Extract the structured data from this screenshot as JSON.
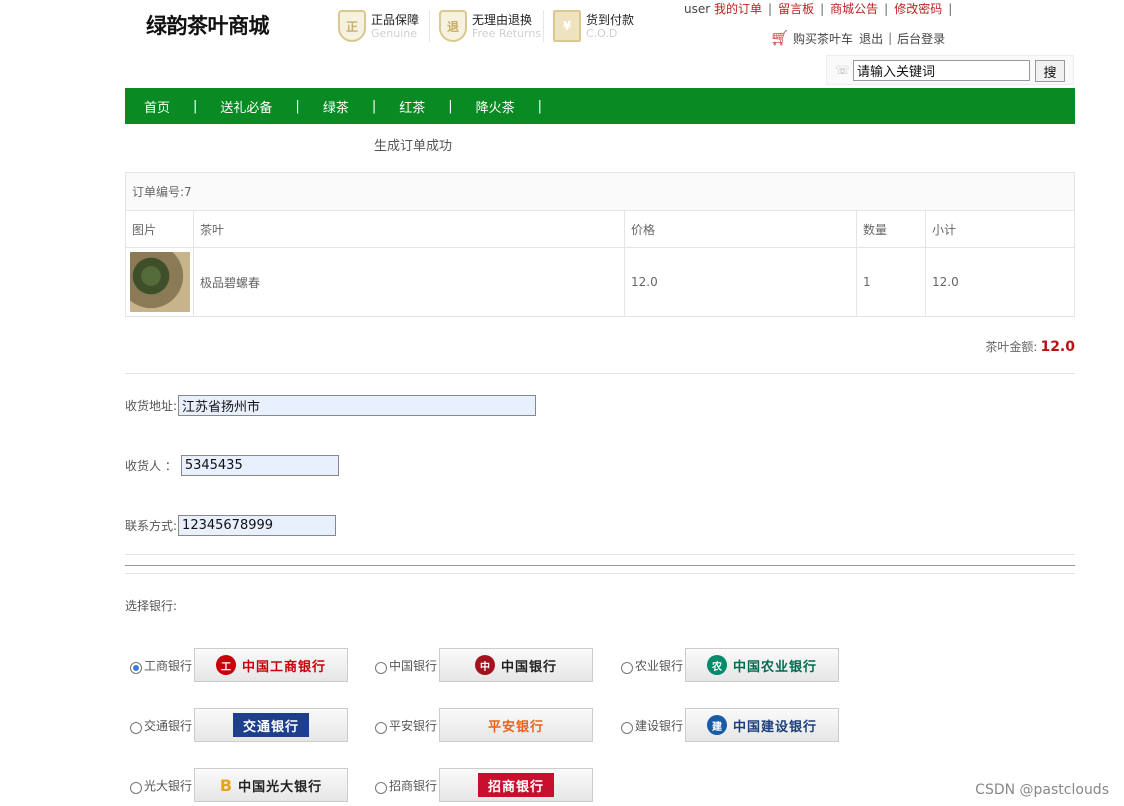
{
  "header": {
    "logo": "绿韵茶叶商城",
    "promos": [
      {
        "icon": "shield-icon",
        "mark": "正",
        "title": "正品保障",
        "sub": "Genuine"
      },
      {
        "icon": "return-icon",
        "mark": "退",
        "title": "无理由退换",
        "sub": "Free Returns"
      },
      {
        "icon": "cod-icon",
        "mark": "¥",
        "title": "货到付款",
        "sub": "C.O.D"
      }
    ],
    "user": "user",
    "links": [
      "我的订单",
      "留言板",
      "商城公告",
      "修改密码"
    ],
    "cart": "购买茶叶车",
    "logout": "退出",
    "admin": "后台登录"
  },
  "search": {
    "value": "请输入关键词",
    "button": "搜"
  },
  "nav": [
    "首页",
    "送礼必备",
    "绿茶",
    "红茶",
    "降火茶"
  ],
  "status": "生成订单成功",
  "order": {
    "id_label": "订单编号:7",
    "columns": [
      "图片",
      "茶叶",
      "价格",
      "数量",
      "小计"
    ],
    "items": [
      {
        "name": "极品碧螺春",
        "price": "12.0",
        "qty": "1",
        "subtotal": "12.0"
      }
    ],
    "total_label": "茶叶金额:",
    "total": "12.0"
  },
  "form": {
    "address_label": "收货地址:",
    "address": "江苏省扬州市",
    "receiver_label": "收货人 ：",
    "receiver": "5345435",
    "phone_label": "联系方式:",
    "phone": "12345678999"
  },
  "banks": {
    "label": "选择银行:",
    "items": [
      {
        "name": "工商银行",
        "logo": "中国工商银行",
        "selected": true
      },
      {
        "name": "中国银行",
        "logo": "中国银行",
        "selected": false
      },
      {
        "name": "农业银行",
        "logo": "中国农业银行",
        "selected": false
      },
      {
        "name": "交通银行",
        "logo": "交通银行",
        "selected": false
      },
      {
        "name": "平安银行",
        "logo": "平安银行",
        "selected": false
      },
      {
        "name": "建设银行",
        "logo": "中国建设银行",
        "selected": false
      },
      {
        "name": "光大银行",
        "logo": "中国光大银行",
        "selected": false
      },
      {
        "name": "招商银行",
        "logo": "招商银行",
        "selected": false
      }
    ]
  },
  "watermark": "CSDN @pastclouds",
  "colors": {
    "nav_bg": "#0a8a23",
    "link": "#bb2222",
    "total": "#bb1111"
  }
}
